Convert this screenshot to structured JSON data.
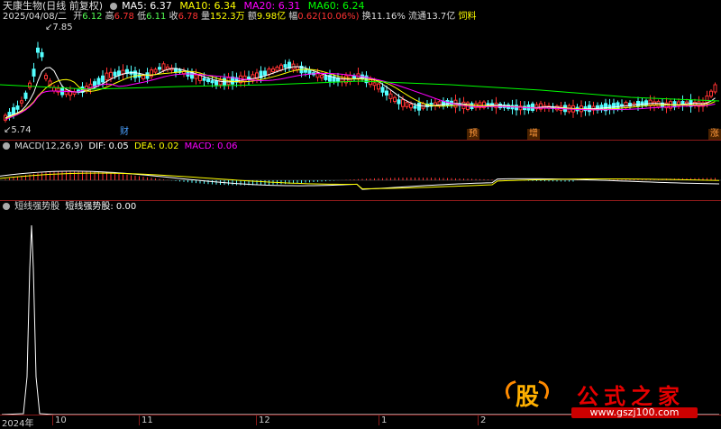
{
  "header": {
    "title": "天康生物(日线 前复权)",
    "ma5": "MA5: 6.37",
    "ma10": "MA10: 6.34",
    "ma20": "MA20: 6.31",
    "ma60": "MA60: 6.24",
    "date": "2025/04/08/二",
    "open_label": "开",
    "open": "6.12",
    "high_label": "高",
    "high": "6.78",
    "low_label": "低",
    "low": "6.11",
    "close_label": "收",
    "close": "6.78",
    "vol_label": "量",
    "vol": "152.3万",
    "amt_label": "额",
    "amt": "9.98亿",
    "chg_label": "幅",
    "chg": "0.62(10.06%)",
    "turn_label": "换",
    "turn": "11.16%",
    "float_label": "流通",
    "float": "13.7亿",
    "industry": "饲料"
  },
  "price_marks": {
    "high_mark": "7.85",
    "low_mark": "5.74"
  },
  "event_tags": [
    "财",
    "预",
    "增",
    "涨"
  ],
  "macd_header": {
    "title": "MACD(12,26,9)",
    "dif": "DIF: 0.05",
    "dea": "DEA: 0.02",
    "macd": "MACD: 0.06"
  },
  "indicator_header": {
    "title": "短线强势股",
    "value_label": "短线强势股: 0.00"
  },
  "x_axis": [
    "2024年",
    "10",
    "11",
    "12",
    "1",
    "2"
  ],
  "watermark": {
    "badge": "股",
    "name": "公式之家",
    "url": "www.gszj100.com"
  },
  "colors": {
    "up": "#ff3232",
    "down": "#54ffff",
    "ma5": "#ffffff",
    "ma10": "#ffff00",
    "ma20": "#ff00ff",
    "ma60": "#00ff00",
    "grid": "#8a1a1a"
  }
}
